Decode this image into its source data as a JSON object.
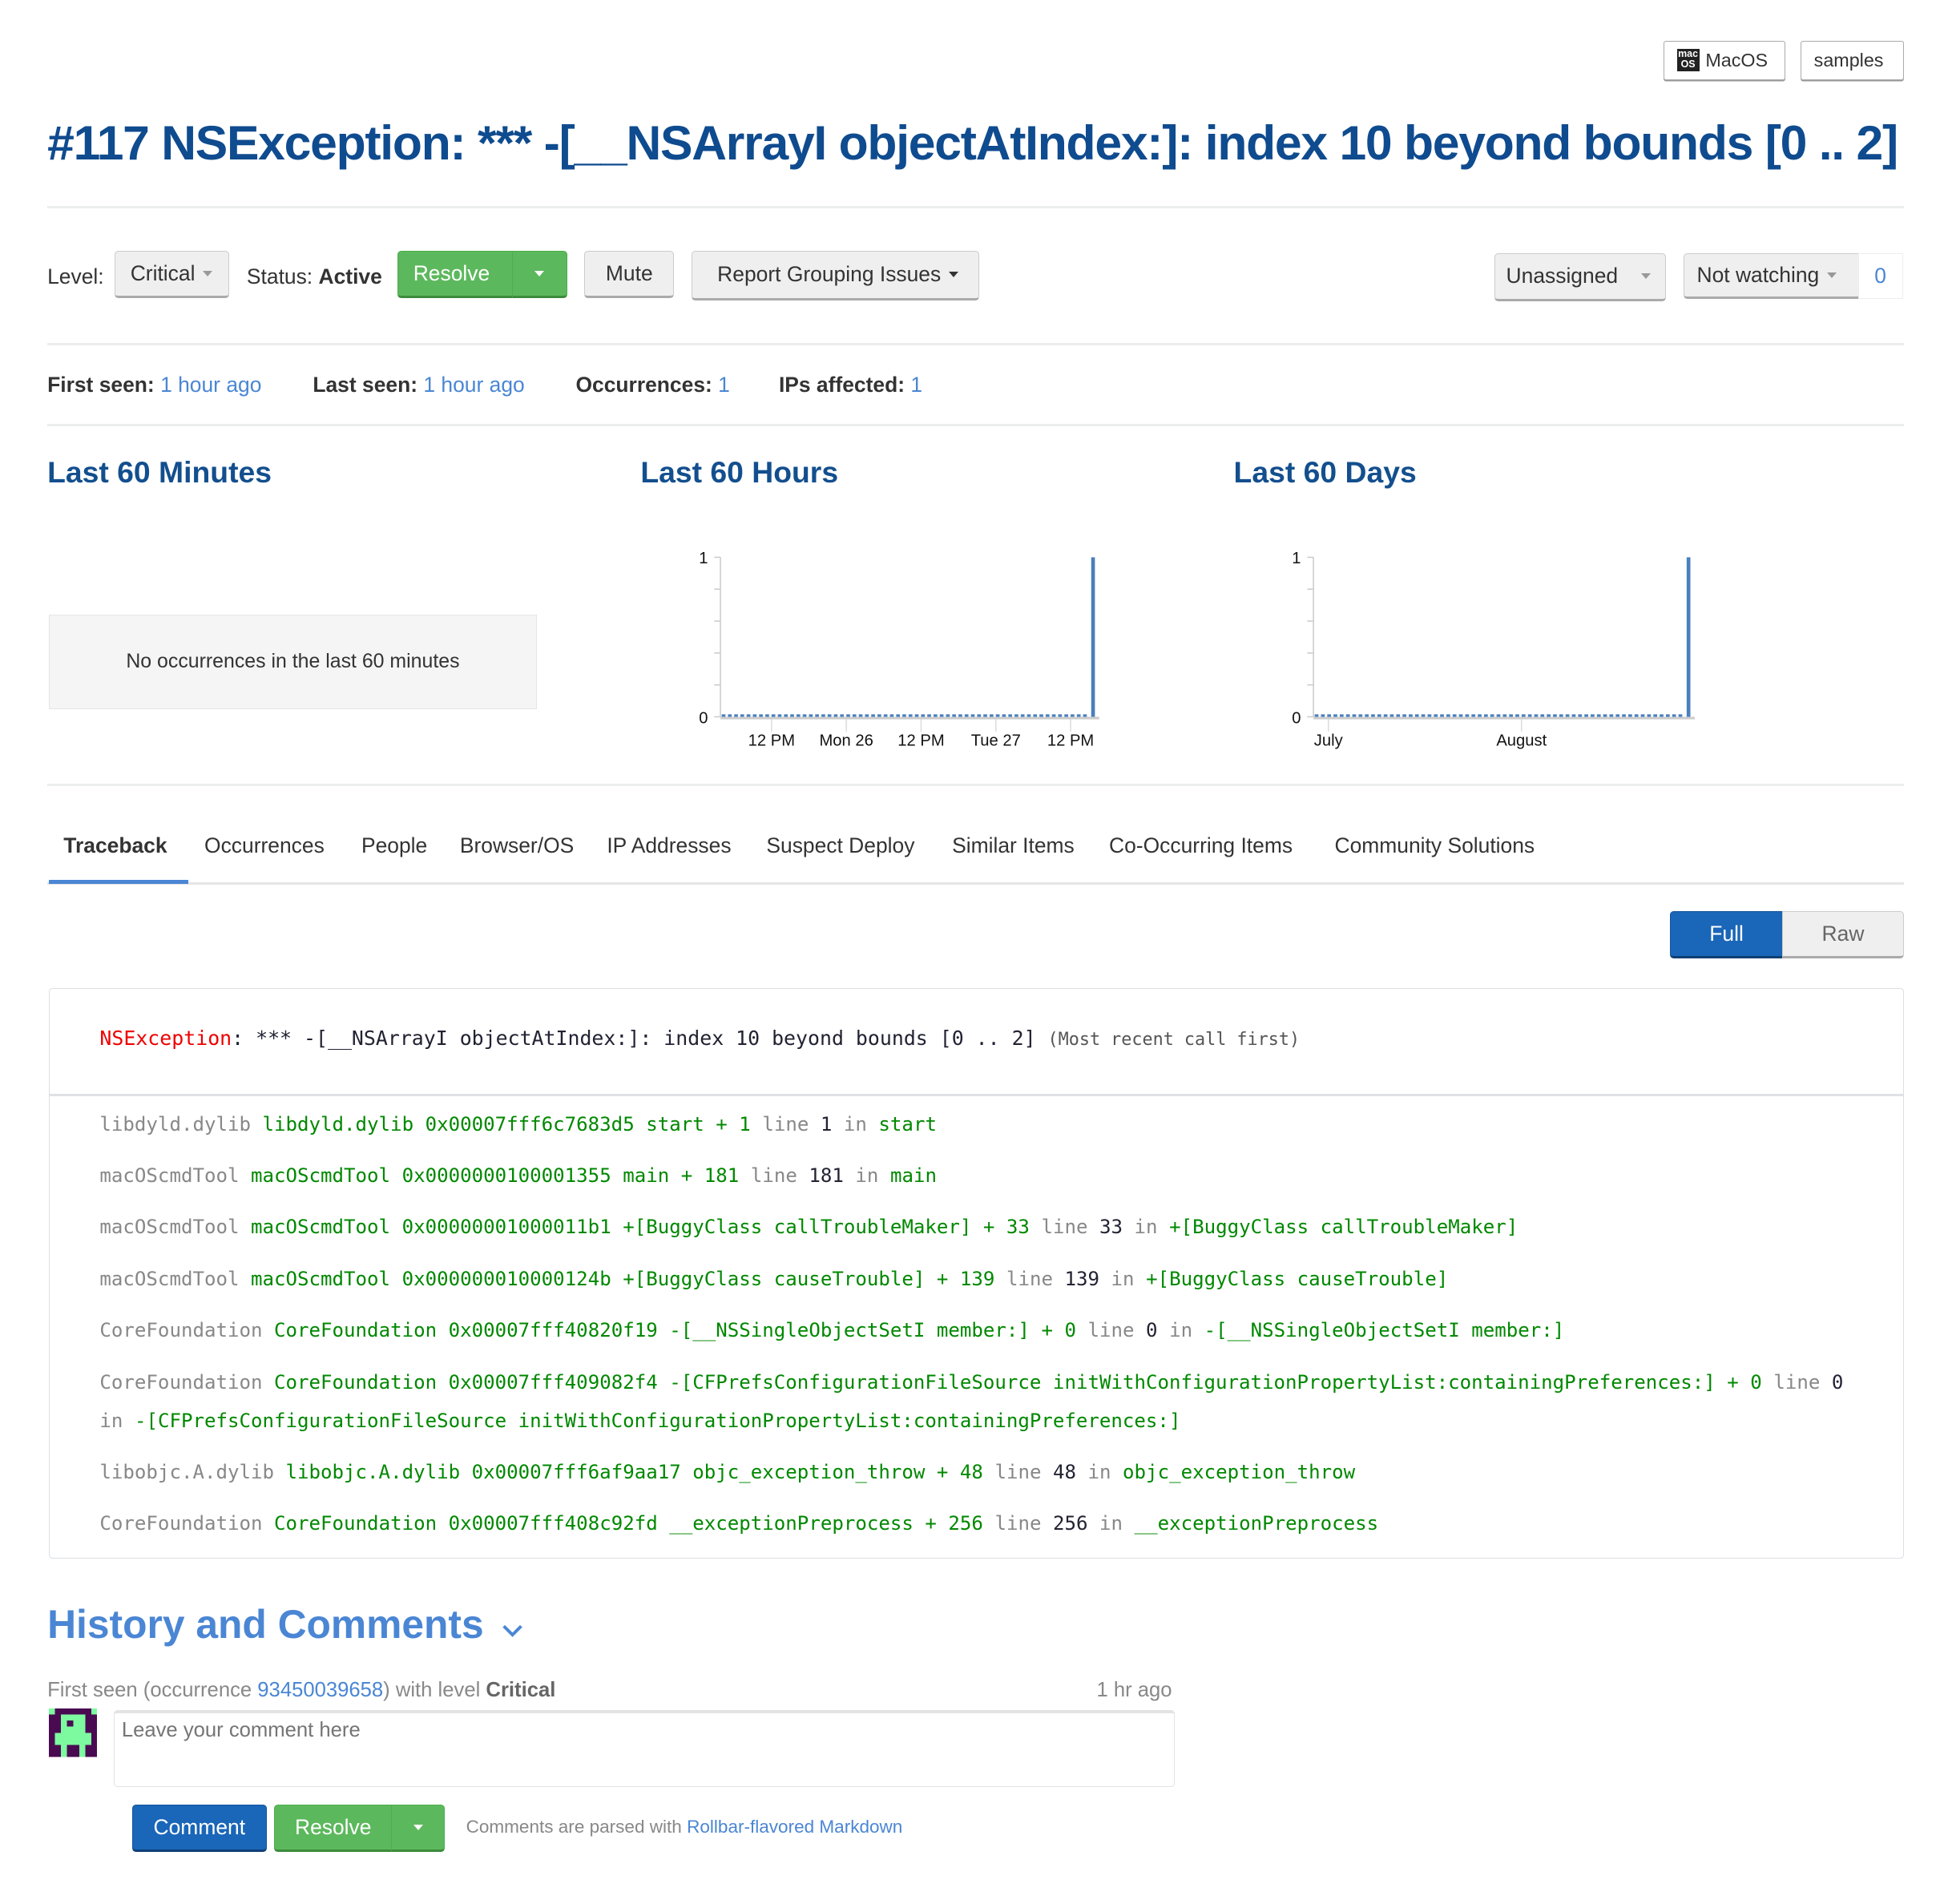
{
  "badges": [
    {
      "label": "MacOS",
      "icon": "macos-logo-icon"
    },
    {
      "label": "samples"
    }
  ],
  "title": "#117 NSException: *** -[__NSArrayI objectAtIndex:]: index 10 beyond bounds [0 .. 2]",
  "toolbar": {
    "level_label": "Level:",
    "level_value": "Critical",
    "status_label": "Status:",
    "status_value": "Active",
    "resolve": "Resolve",
    "mute": "Mute",
    "report_grouping": "Report Grouping Issues",
    "assignee": "Unassigned",
    "watching": "Not watching",
    "watch_count": "0"
  },
  "stats": {
    "first_seen_label": "First seen:",
    "first_seen": "1 hour ago",
    "last_seen_label": "Last seen:",
    "last_seen": "1 hour ago",
    "occurrences_label": "Occurrences:",
    "occurrences": "1",
    "ips_label": "IPs affected:",
    "ips": "1"
  },
  "sections": {
    "minutes": "Last 60 Minutes",
    "hours": "Last 60 Hours",
    "days": "Last 60 Days",
    "no_occurrences": "No occurrences in the last 60 minutes"
  },
  "chart_data": [
    {
      "type": "bar",
      "title": "Last 60 Hours",
      "ylim": [
        0,
        1
      ],
      "yticks": [
        "0",
        "1"
      ],
      "xticks": [
        "12 PM",
        "Mon 26",
        "12 PM",
        "Tue 27",
        "12 PM"
      ],
      "values": [
        0,
        0,
        0,
        0,
        0,
        0,
        0,
        0,
        0,
        0,
        0,
        0,
        0,
        0,
        0,
        0,
        0,
        0,
        0,
        0,
        0,
        0,
        0,
        0,
        0,
        0,
        0,
        0,
        0,
        0,
        0,
        0,
        0,
        0,
        0,
        0,
        0,
        0,
        0,
        0,
        0,
        0,
        0,
        0,
        0,
        0,
        0,
        0,
        0,
        0,
        0,
        0,
        0,
        0,
        0,
        0,
        0,
        0,
        0,
        1
      ],
      "color": "#4a7fbd"
    },
    {
      "type": "bar",
      "title": "Last 60 Days",
      "ylim": [
        0,
        1
      ],
      "yticks": [
        "0",
        "1"
      ],
      "xticks": [
        "July",
        "August"
      ],
      "values": [
        0,
        0,
        0,
        0,
        0,
        0,
        0,
        0,
        0,
        0,
        0,
        0,
        0,
        0,
        0,
        0,
        0,
        0,
        0,
        0,
        0,
        0,
        0,
        0,
        0,
        0,
        0,
        0,
        0,
        0,
        0,
        0,
        0,
        0,
        0,
        0,
        0,
        0,
        0,
        0,
        0,
        0,
        0,
        0,
        0,
        0,
        0,
        0,
        0,
        0,
        0,
        0,
        0,
        0,
        0,
        0,
        0,
        0,
        0,
        1
      ],
      "color": "#4a7fbd"
    }
  ],
  "tabs": [
    "Traceback",
    "Occurrences",
    "People",
    "Browser/OS",
    "IP Addresses",
    "Suspect Deploy",
    "Similar Items",
    "Co-Occurring Items",
    "Community Solutions"
  ],
  "view_toggle": {
    "full": "Full",
    "raw": "Raw"
  },
  "traceback": {
    "exception_class": "NSException",
    "message": ": *** -[__NSArrayI objectAtIndex:]: index 10 beyond bounds [0 .. 2]",
    "note": "(Most recent call first)",
    "line_word": "line",
    "in_word": "in",
    "frames": [
      {
        "lib": "libdyld.dylib",
        "file": "libdyld.dylib",
        "addr": "0x00007fff6c7683d5",
        "func": "start",
        "offset": "+ 1",
        "line": "1",
        "method": "start"
      },
      {
        "lib": "macOScmdTool",
        "file": "macOScmdTool",
        "addr": "0x0000000100001355",
        "func": "main",
        "offset": "+ 181",
        "line": "181",
        "method": "main"
      },
      {
        "lib": "macOScmdTool",
        "file": "macOScmdTool",
        "addr": "0x00000001000011b1",
        "func": "+[BuggyClass callTroubleMaker]",
        "offset": "+ 33",
        "line": "33",
        "method": "+[BuggyClass callTroubleMaker]"
      },
      {
        "lib": "macOScmdTool",
        "file": "macOScmdTool",
        "addr": "0x000000010000124b",
        "func": "+[BuggyClass causeTrouble]",
        "offset": "+ 139",
        "line": "139",
        "method": "+[BuggyClass causeTrouble]"
      },
      {
        "lib": "CoreFoundation",
        "file": "CoreFoundation",
        "addr": "0x00007fff40820f19",
        "func": "-[__NSSingleObjectSetI member:]",
        "offset": "+ 0",
        "line": "0",
        "method": "-[__NSSingleObjectSetI member:]"
      },
      {
        "lib": "CoreFoundation",
        "file": "CoreFoundation",
        "addr": "0x00007fff409082f4",
        "func": "-[CFPrefsConfigurationFileSource initWithConfigurationPropertyList:containingPreferences:]",
        "offset": "+ 0",
        "line": "0",
        "method": "-[CFPrefsConfigurationFileSource initWithConfigurationPropertyList:containingPreferences:]"
      },
      {
        "lib": "libobjc.A.dylib",
        "file": "libobjc.A.dylib",
        "addr": "0x00007fff6af9aa17",
        "func": "objc_exception_throw",
        "offset": "+ 48",
        "line": "48",
        "method": "objc_exception_throw"
      },
      {
        "lib": "CoreFoundation",
        "file": "CoreFoundation",
        "addr": "0x00007fff408c92fd",
        "func": "__exceptionPreprocess",
        "offset": "+ 256",
        "line": "256",
        "method": "__exceptionPreprocess"
      }
    ]
  },
  "history": {
    "heading": "History and Comments",
    "event_prefix": "First seen (occurrence ",
    "occurrence_id": "93450039658",
    "event_mid": ") with level ",
    "event_level": "Critical",
    "event_time": "1 hr ago",
    "comment_placeholder": "Leave your comment here",
    "comment_button": "Comment",
    "resolve_button": "Resolve",
    "markdown_note": "Comments are parsed with ",
    "markdown_link": "Rollbar-flavored Markdown"
  }
}
